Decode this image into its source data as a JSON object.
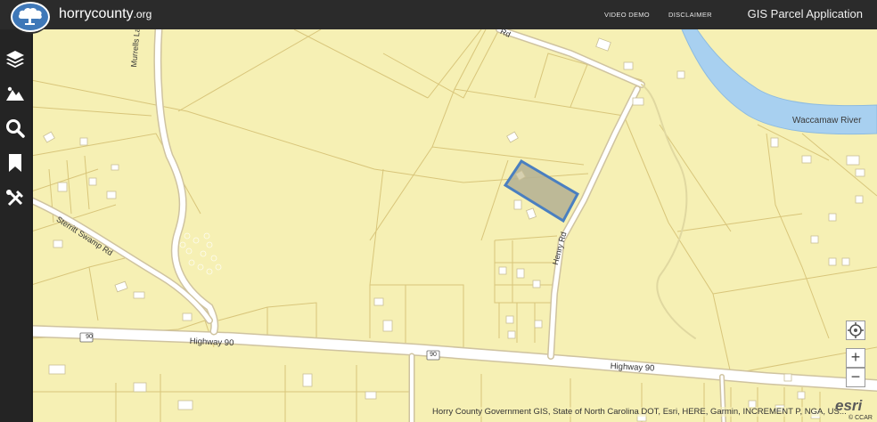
{
  "header": {
    "brand_name": "horrycounty",
    "brand_tld": ".org",
    "nav": {
      "video_demo": "VIDEO DEMO",
      "disclaimer": "DISCLAIMER"
    },
    "app_title": "GIS Parcel Application"
  },
  "sidebar": {
    "tools": [
      {
        "name": "layers",
        "icon": "layers-icon"
      },
      {
        "name": "basemap",
        "icon": "mountain-icon"
      },
      {
        "name": "search",
        "icon": "search-icon"
      },
      {
        "name": "bookmarks",
        "icon": "bookmark-icon"
      },
      {
        "name": "tools",
        "icon": "tools-icon"
      }
    ]
  },
  "map": {
    "labels": {
      "river": "Waccamaw River",
      "murrells_landing_rd": "Murrells Landing Rd",
      "sterritt_swamp_rd": "Sterritt Swamp Rd",
      "highway_90_west": "Highway 90",
      "highway_90_east": "Highway 90",
      "henry_rd": "Henry Rd",
      "route_shield_west": "90",
      "route_shield_center": "90",
      "top_road_fragment": "Rd"
    },
    "colors": {
      "land": "#f6f0b4",
      "parcel_line": "#d8c57a",
      "road": "#ffffff",
      "water": "#a8d0f0",
      "selected_parcel_outline": "#4a7fc0",
      "selected_parcel_fill": "#b7b293"
    }
  },
  "controls": {
    "locate_icon": "locate-icon",
    "zoom_in": "+",
    "zoom_out": "−"
  },
  "attribution": "Horry County Government GIS, State of North Carolina DOT, Esri, HERE, Garmin, INCREMENT P, NGA, US...",
  "esri_logo": "esri",
  "esri_sub": "© CCAR"
}
